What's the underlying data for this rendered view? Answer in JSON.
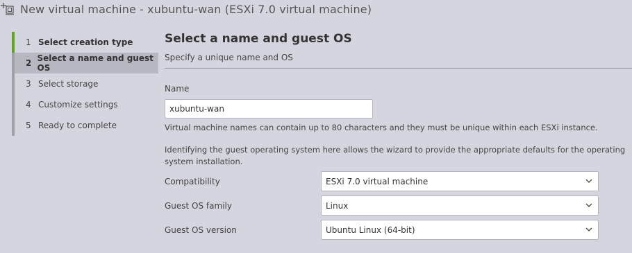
{
  "window": {
    "title": "New virtual machine - xubuntu-wan (ESXi 7.0 virtual machine)",
    "icon": "new-vm-icon"
  },
  "wizard": {
    "steps": [
      {
        "num": "1",
        "label": "Select creation type",
        "state": "done"
      },
      {
        "num": "2",
        "label": "Select a name and guest OS",
        "state": "active"
      },
      {
        "num": "3",
        "label": "Select storage",
        "state": "pending"
      },
      {
        "num": "4",
        "label": "Customize settings",
        "state": "pending"
      },
      {
        "num": "5",
        "label": "Ready to complete",
        "state": "pending"
      }
    ]
  },
  "page": {
    "title": "Select a name and guest OS",
    "subtitle": "Specify a unique name and OS",
    "name_label": "Name",
    "name_value": "xubuntu-wan",
    "name_hint": "Virtual machine names can contain up to 80 characters and they must be unique within each ESXi instance.",
    "os_description": "Identifying the guest operating system here allows the wizard to provide the appropriate defaults for the operating system installation.",
    "fields": [
      {
        "label": "Compatibility",
        "value": "ESXi 7.0 virtual machine"
      },
      {
        "label": "Guest OS family",
        "value": "Linux"
      },
      {
        "label": "Guest OS version",
        "value": "Ubuntu Linux (64-bit)"
      }
    ]
  },
  "colors": {
    "background": "#d5d5df",
    "active_step_bg": "#b8b8c2",
    "done_step_accent": "#62a420"
  }
}
